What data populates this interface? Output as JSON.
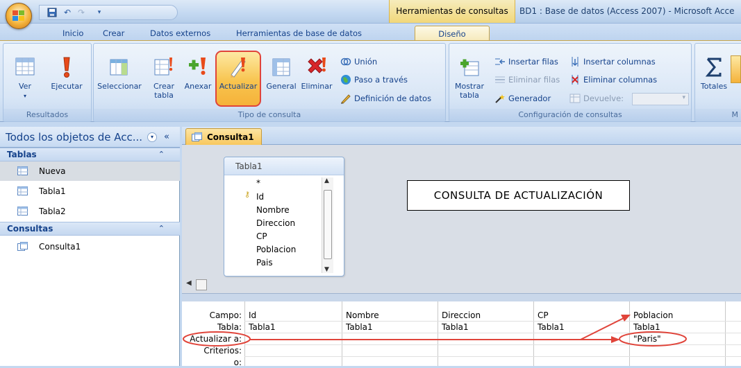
{
  "titlebar": {
    "context_tools": "Herramientas de consultas",
    "window_title": "BD1 : Base de datos (Access 2007) - Microsoft Acce"
  },
  "tabs": [
    "Inicio",
    "Crear",
    "Datos externos",
    "Herramientas de base de datos",
    "Diseño"
  ],
  "ribbon": {
    "resultados": {
      "label": "Resultados",
      "ver": "Ver",
      "ejecutar": "Ejecutar"
    },
    "tipo": {
      "label": "Tipo de consulta",
      "seleccionar": "Seleccionar",
      "crear_tabla_1": "Crear",
      "crear_tabla_2": "tabla",
      "anexar": "Anexar",
      "actualizar": "Actualizar",
      "general": "General",
      "eliminar": "Eliminar",
      "union": "Unión",
      "paso": "Paso a través",
      "definicion": "Definición de datos"
    },
    "config": {
      "label": "Configuración de consultas",
      "mostrar_1": "Mostrar",
      "mostrar_2": "tabla",
      "insertar_filas": "Insertar filas",
      "eliminar_filas": "Eliminar filas",
      "generador": "Generador",
      "insertar_columnas": "Insertar columnas",
      "eliminar_columnas": "Eliminar columnas",
      "devuelve": "Devuelve:"
    },
    "totales": {
      "label": "Totales",
      "group_label": "M"
    }
  },
  "nav": {
    "header": "Todos los objetos de Acc...",
    "sections": [
      {
        "title": "Tablas",
        "items": [
          "Nueva",
          "Tabla1",
          "Tabla2"
        ]
      },
      {
        "title": "Consultas",
        "items": [
          "Consulta1"
        ]
      }
    ]
  },
  "document": {
    "tab": "Consulta1",
    "table": {
      "name": "Tabla1",
      "fields": [
        "*",
        "Id",
        "Nombre",
        "Direccion",
        "CP",
        "Poblacion",
        "Pais"
      ]
    },
    "annotation": "CONSULTA DE ACTUALIZACIÓN",
    "grid": {
      "row_labels": [
        "Campo:",
        "Tabla:",
        "Actualizar a:",
        "Criterios:",
        "o:"
      ],
      "columns": [
        {
          "campo": "Id",
          "tabla": "Tabla1",
          "actualizar": ""
        },
        {
          "campo": "Nombre",
          "tabla": "Tabla1",
          "actualizar": ""
        },
        {
          "campo": "Direccion",
          "tabla": "Tabla1",
          "actualizar": ""
        },
        {
          "campo": "CP",
          "tabla": "Tabla1",
          "actualizar": ""
        },
        {
          "campo": "Poblacion",
          "tabla": "Tabla1",
          "actualizar": "\"Paris\""
        }
      ]
    }
  },
  "colors": {
    "highlight_red": "#e0443a",
    "active_orange": "#f8c44e",
    "ribbon_text": "#15428b"
  }
}
